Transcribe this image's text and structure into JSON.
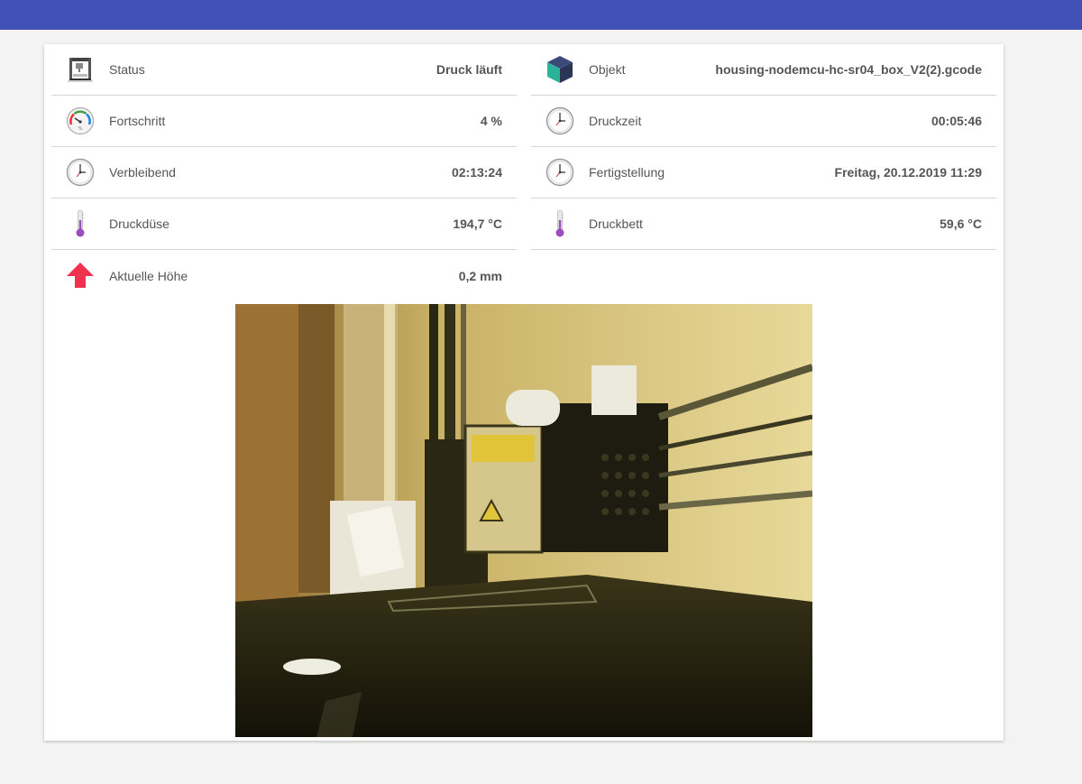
{
  "left_rows": [
    {
      "label": "Status",
      "value": "Druck läuft",
      "icon": "printer-icon"
    },
    {
      "label": "Fortschritt",
      "value": "4 %",
      "icon": "gauge-icon"
    },
    {
      "label": "Verbleibend",
      "value": "02:13:24",
      "icon": "clock-icon"
    },
    {
      "label": "Druckdüse",
      "value": "194,7 °C",
      "icon": "thermometer-icon"
    },
    {
      "label": "Aktuelle Höhe",
      "value": "0,2 mm",
      "icon": "arrow-up-icon"
    }
  ],
  "right_rows": [
    {
      "label": "Objekt",
      "value": "housing-nodemcu-hc-sr04_box_V2(2).gcode",
      "icon": "cube-icon"
    },
    {
      "label": "Druckzeit",
      "value": "00:05:46",
      "icon": "clock-icon"
    },
    {
      "label": "Fertigstellung",
      "value": "Freitag, 20.12.2019 11:29",
      "icon": "clock-icon"
    },
    {
      "label": "Druckbett",
      "value": "59,6 °C",
      "icon": "thermometer-icon"
    }
  ],
  "colors": {
    "header": "#3f51b5",
    "arrow": "#f0324f",
    "thermometer": "#9b4fbf",
    "cube_top": "#3b4a78",
    "cube_side": "#2bb39a"
  },
  "camera": {
    "alt": "Webcam"
  }
}
